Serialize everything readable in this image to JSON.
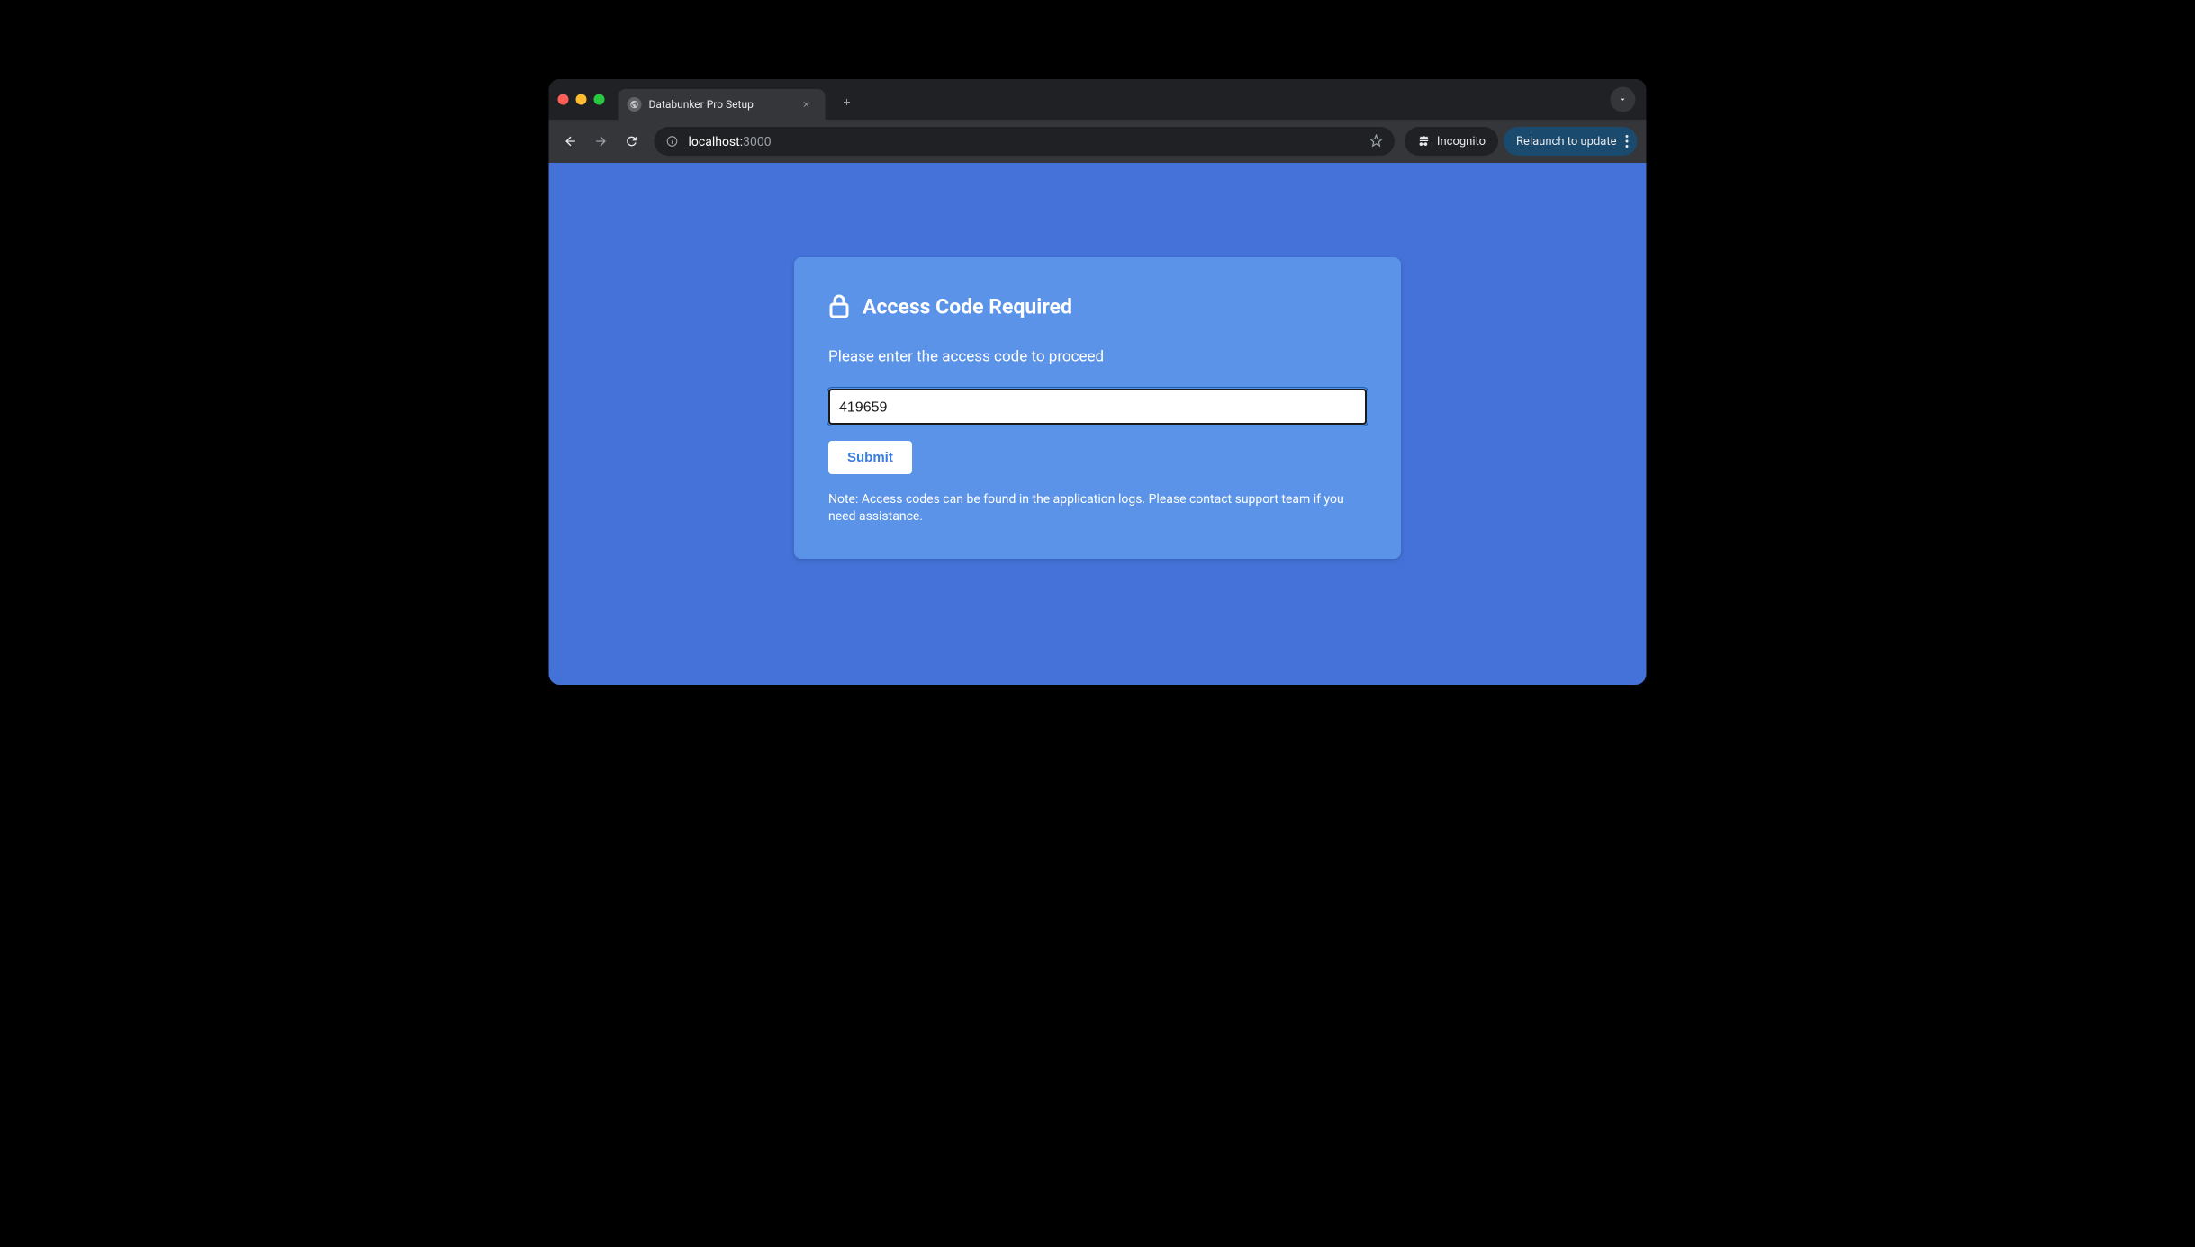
{
  "browser": {
    "tab_title": "Databunker Pro Setup",
    "url_host": "localhost:",
    "url_port": "3000",
    "incognito_label": "Incognito",
    "relaunch_label": "Relaunch to update"
  },
  "card": {
    "title": "Access Code Required",
    "prompt": "Please enter the access code to proceed",
    "input_value": "419659",
    "submit_label": "Submit",
    "note": "Note: Access codes can be found in the application logs. Please contact support team if you need assistance."
  }
}
